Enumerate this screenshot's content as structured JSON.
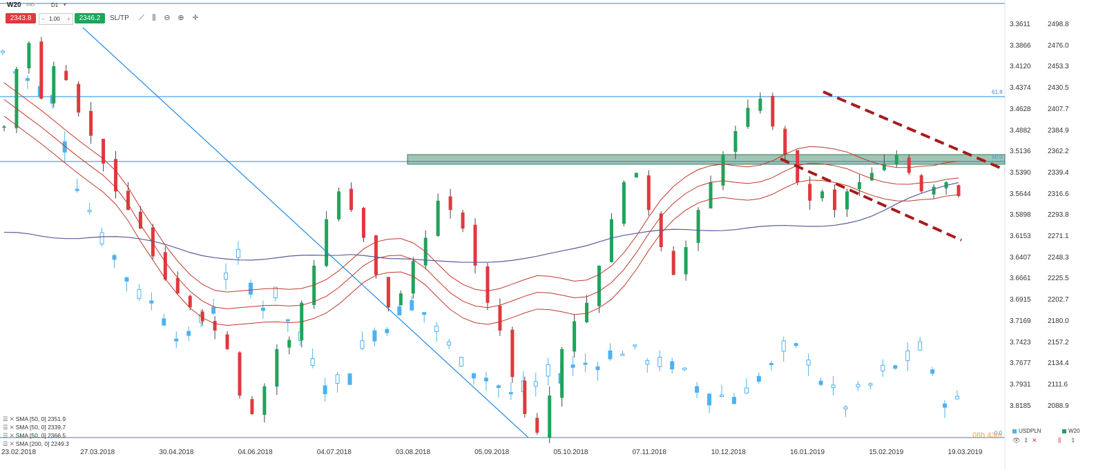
{
  "toolbar": {
    "symbol": "W20",
    "symbol_sub": "IND",
    "timeframe": "D1",
    "sell_price": "2343.8",
    "quantity": "1.00",
    "buy_price": "2346.2",
    "sltp_label": "SL/TP"
  },
  "colors": {
    "up_candle": "#21a35b",
    "down_candle": "#e0393e",
    "usdpln_candle": "#4db2f0",
    "sma_red": "#c0392b",
    "sma_200": "#5a5b9a",
    "trendline": "#1e88e5",
    "channel": "#a61c1c",
    "zone": "#2f7d5a"
  },
  "chart_data": {
    "type": "candlestick",
    "x_ticks": [
      "23.02.2018",
      "27.03.2018",
      "30.04.2018",
      "04.06.2018",
      "04.07.2018",
      "03.08.2018",
      "05.09.2018",
      "05.10.2018",
      "07.11.2018",
      "10.12.2018",
      "16.01.2019",
      "15.02.2019",
      "19.03.2019"
    ],
    "y_right_w20": [
      "2498.8",
      "2476.0",
      "2453.3",
      "2430.5",
      "2407.7",
      "2384.9",
      "2362.2",
      "2339.4",
      "2316.6",
      "2293.8",
      "2271.1",
      "2248.3",
      "2225.5",
      "2202.7",
      "2180.0",
      "2157.2",
      "2134.4",
      "2111.6",
      "2088.9"
    ],
    "y_left_usdpln": [
      "3.3611",
      "3.3866",
      "3.4120",
      "3.4374",
      "3.4628",
      "3.4882",
      "3.5136",
      "3.5390",
      "3.5644",
      "3.5898",
      "3.6153",
      "3.6407",
      "3.6661",
      "3.6915",
      "3.7169",
      "3.7423",
      "3.7677",
      "3.7931",
      "3.8185"
    ],
    "fib_levels": [
      {
        "label": "61.8",
        "price": 2425
      },
      {
        "label": "50.0",
        "price": 2341
      },
      {
        "label": "0.0",
        "price": 2075
      }
    ],
    "indicators": [
      {
        "name": "SMA [50, 0]",
        "value": "2351.9"
      },
      {
        "name": "SMA [50, 0]",
        "value": "2339.7"
      },
      {
        "name": "SMA [50, 0]",
        "value": "2366.5"
      },
      {
        "name": "SMA [200, 0]",
        "value": "2249.3"
      }
    ],
    "series": [
      {
        "name": "USDPLN"
      },
      {
        "name": "W20"
      }
    ],
    "w20_close_path": [
      2390,
      2452,
      2480,
      2420,
      2455,
      2440,
      2405,
      2380,
      2350,
      2320,
      2300,
      2280,
      2250,
      2225,
      2210,
      2195,
      2180,
      2170,
      2150,
      2100,
      2080,
      2110,
      2150,
      2160,
      2200,
      2240,
      2290,
      2320,
      2300,
      2270,
      2230,
      2195,
      2210,
      2245,
      2270,
      2310,
      2300,
      2280,
      2240,
      2200,
      2170,
      2120,
      2080,
      2060,
      2100,
      2150,
      2180,
      2200,
      2240,
      2290,
      2330,
      2340,
      2300,
      2260,
      2230,
      2260,
      2300,
      2330,
      2360,
      2385,
      2410,
      2420,
      2390,
      2360,
      2330,
      2310,
      2320,
      2300,
      2320,
      2330,
      2340,
      2350,
      2360,
      2340,
      2320,
      2325,
      2330,
      2315
    ]
  },
  "timer": "08h 43m",
  "status": {
    "usdpln_label": "USDPLN",
    "w20_label": "W20"
  }
}
